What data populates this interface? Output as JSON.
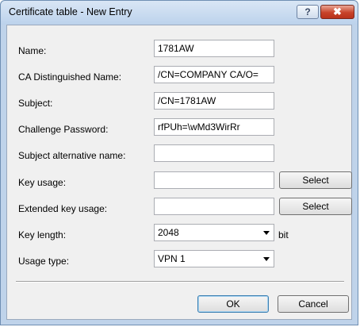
{
  "window": {
    "title": "Certificate table - New Entry",
    "help_label": "?",
    "close_label": "✖"
  },
  "form": {
    "name_label": "Name:",
    "name_value": "1781AW",
    "ca_dn_label": "CA Distinguished Name:",
    "ca_dn_value": "/CN=COMPANY CA/O=",
    "subject_label": "Subject:",
    "subject_value": "/CN=1781AW",
    "challenge_label": "Challenge Password:",
    "challenge_value": "rfPUh=\\wMd3WirRr",
    "san_label": "Subject alternative name:",
    "san_value": "",
    "key_usage_label": "Key usage:",
    "key_usage_value": "",
    "key_usage_select": "Select",
    "ext_key_usage_label": "Extended key usage:",
    "ext_key_usage_value": "",
    "ext_key_usage_select": "Select",
    "key_length_label": "Key length:",
    "key_length_value": "2048",
    "key_length_unit": "bit",
    "usage_type_label": "Usage type:",
    "usage_type_value": "VPN 1"
  },
  "buttons": {
    "ok_label": "OK",
    "cancel_label": "Cancel"
  }
}
